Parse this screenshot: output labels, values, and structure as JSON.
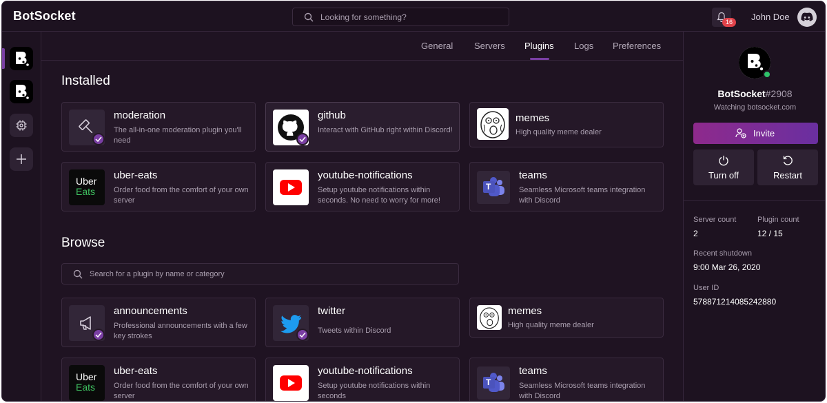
{
  "app": {
    "name": "BotSocket"
  },
  "search": {
    "placeholder": "Looking for something?"
  },
  "notifications": {
    "count": "16"
  },
  "user": {
    "name": "John Doe"
  },
  "tabs": [
    {
      "label": "General"
    },
    {
      "label": "Servers"
    },
    {
      "label": "Plugins",
      "active": true
    },
    {
      "label": "Logs"
    },
    {
      "label": "Preferences"
    }
  ],
  "installed": {
    "title": "Installed",
    "cards": [
      {
        "title": "moderation",
        "desc": "The all-in-one moderation plugin you'll need",
        "icon": "hammer-icon",
        "checked": true
      },
      {
        "title": "github",
        "desc": "Interact with GitHub right within Discord!",
        "icon": "github-icon",
        "checked": true
      },
      {
        "title": "memes",
        "desc": "High quality meme dealer",
        "icon": "meme-face-icon",
        "checked": false
      },
      {
        "title": "uber-eats",
        "desc": "Order food from the comfort of your own server",
        "icon": "uber-eats-icon",
        "checked": false
      },
      {
        "title": "youtube-notifications",
        "desc": "Setup youtube notifications within seconds. No need to worry for more!",
        "icon": "youtube-icon",
        "checked": false
      },
      {
        "title": "teams",
        "desc": "Seamless Microsoft teams integration with Discord",
        "icon": "teams-icon",
        "checked": false
      }
    ]
  },
  "browse": {
    "title": "Browse",
    "search_placeholder": "Search for a plugin by name or category",
    "cards": [
      {
        "title": "announcements",
        "desc": "Professional announcements with a few key strokes",
        "icon": "megaphone-icon",
        "checked": true
      },
      {
        "title": "twitter",
        "desc": "Tweets within Discord",
        "icon": "twitter-icon",
        "checked": true
      },
      {
        "title": "memes",
        "desc": "High quality meme dealer",
        "icon": "meme-face-icon",
        "checked": false
      },
      {
        "title": "uber-eats",
        "desc": "Order food from the comfort of your own server",
        "icon": "uber-eats-icon",
        "checked": false
      },
      {
        "title": "youtube-notifications",
        "desc": "Setup youtube notifications within seconds",
        "icon": "youtube-icon",
        "checked": false
      },
      {
        "title": "teams",
        "desc": "Seamless Microsoft teams integration with Discord",
        "icon": "teams-icon",
        "checked": false
      }
    ]
  },
  "icon_text": {
    "uber": "Uber",
    "eats": "Eats",
    "teams_letter": "T"
  },
  "bot": {
    "name": "BotSocket",
    "tag": "#2908",
    "status": "Watching botsocket.com",
    "invite_label": "Invite",
    "turn_off_label": "Turn off",
    "restart_label": "Restart",
    "info": {
      "server_count_label": "Server count",
      "server_count": "2",
      "plugin_count_label": "Plugin count",
      "plugin_count": "12 / 15",
      "recent_shutdown_label": "Recent shutdown",
      "recent_shutdown": "9:00 Mar 26, 2020",
      "user_id_label": "User ID",
      "user_id": "578871214085242880"
    }
  },
  "colors": {
    "accent": "#7a3fa4",
    "background": "#1f1322",
    "online": "#2fc26a",
    "badge": "#e0424a"
  }
}
